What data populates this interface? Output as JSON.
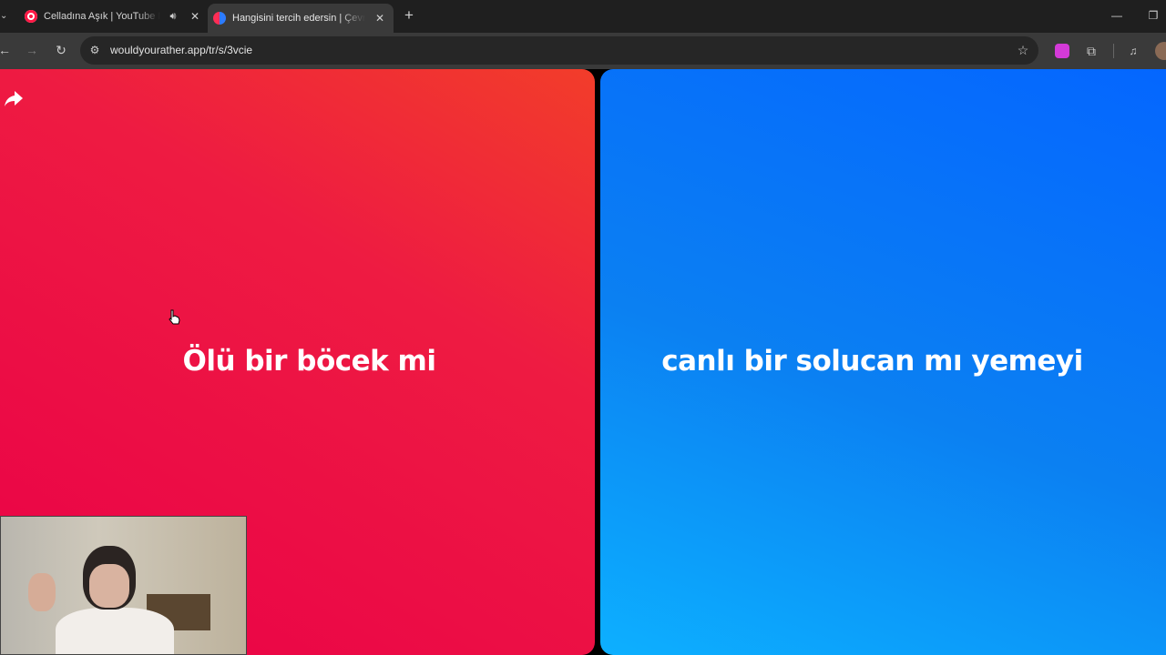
{
  "browser": {
    "tabs": [
      {
        "title": "Celladına Aşık | YouTube M",
        "favicon": "youtube-music-icon",
        "audio": true,
        "active": false
      },
      {
        "title": "Hangisini tercih edersin | Çevrim",
        "favicon": "wouldyourather-icon",
        "audio": false,
        "active": true
      }
    ],
    "url": "wouldyourather.app/tr/s/3vcie"
  },
  "game": {
    "option_left": "Ölü bir böcek mi",
    "option_right": "canlı bir solucan mı yemeyi",
    "left_color": "#ee1b42",
    "right_color": "#0b80f2"
  },
  "icons": {
    "share": "share-icon",
    "cursor": "hand-cursor-icon"
  }
}
